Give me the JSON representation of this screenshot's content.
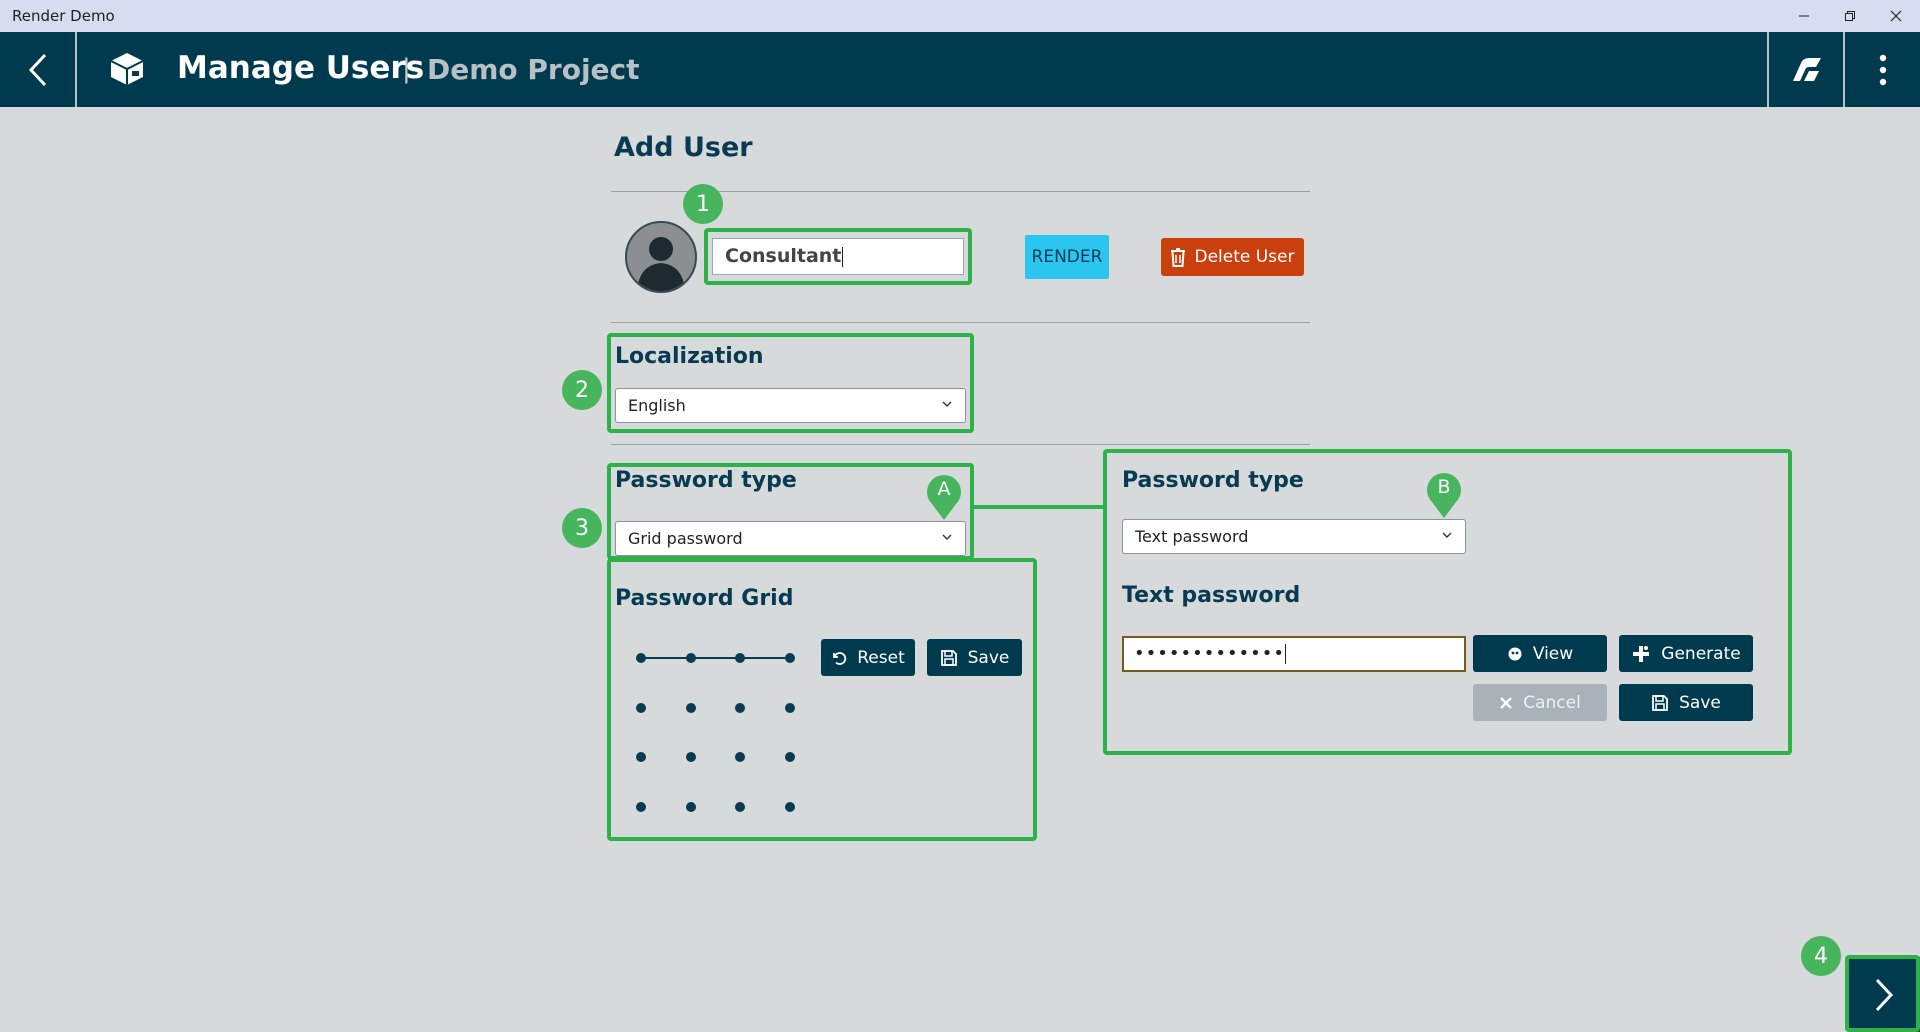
{
  "window": {
    "title": "Render Demo"
  },
  "header": {
    "title": "Manage Users",
    "separator": "|",
    "project": "Demo Project"
  },
  "page": {
    "heading": "Add User"
  },
  "user": {
    "name_value": "Consultant",
    "render_label": "RENDER",
    "delete_label": "Delete User"
  },
  "localization": {
    "label": "Localization",
    "selected": "English"
  },
  "password_a": {
    "label": "Password type",
    "selected": "Grid password"
  },
  "grid": {
    "label": "Password Grid",
    "reset_label": "Reset",
    "save_label": "Save"
  },
  "password_b": {
    "label": "Password type",
    "selected": "Text password",
    "text_label": "Text password",
    "masked_value": "•••••••••••••",
    "view_label": "View",
    "generate_label": "Generate",
    "cancel_label": "Cancel",
    "save_label": "Save"
  },
  "callouts": {
    "one": "1",
    "two": "2",
    "three": "3",
    "four": "4",
    "a": "A",
    "b": "B"
  },
  "colors": {
    "header_bg": "#003a4f",
    "highlight": "#2eb04a",
    "render": "#2bc6f0",
    "delete": "#c9400e",
    "background": "#d6dadb"
  }
}
